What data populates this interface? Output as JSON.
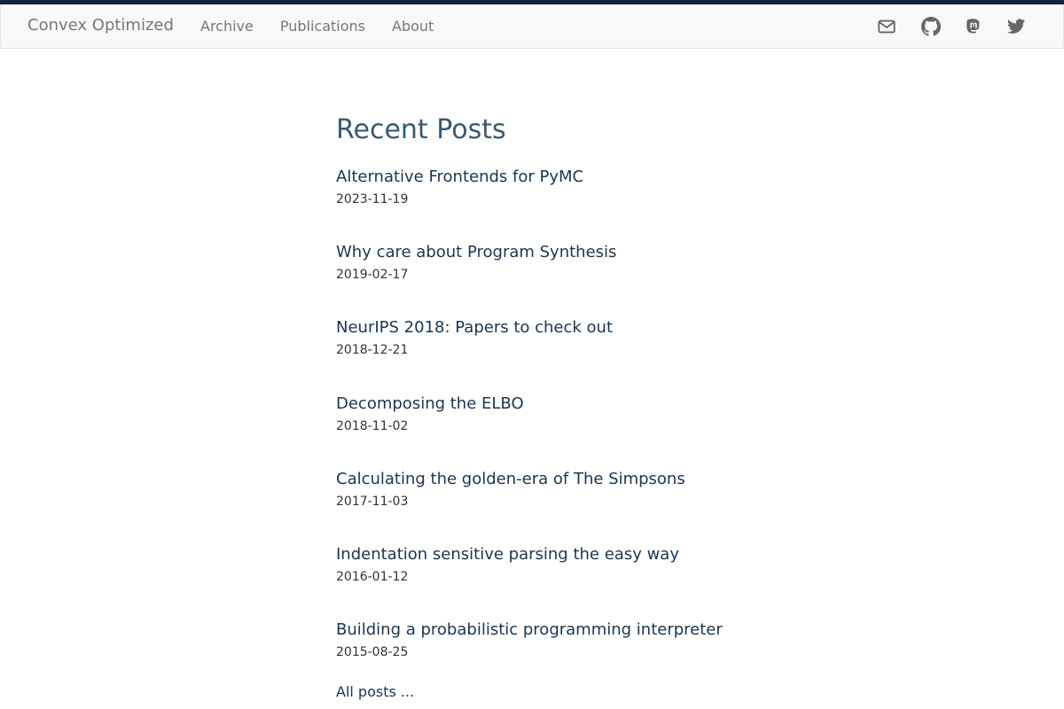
{
  "nav": {
    "brand": "Convex Optimized",
    "links": [
      "Archive",
      "Publications",
      "About"
    ]
  },
  "social_icons": [
    "mail-icon",
    "github-icon",
    "mastodon-icon",
    "twitter-icon"
  ],
  "colors": {
    "topbar": "#14243a",
    "navbar_bg": "#f8f8f8",
    "nav_text": "#777777",
    "heading": "#385a6f",
    "link": "#1b3550"
  },
  "main": {
    "heading": "Recent Posts",
    "posts": [
      {
        "title": "Alternative Frontends for PyMC",
        "date": "2023-11-19"
      },
      {
        "title": "Why care about Program Synthesis",
        "date": "2019-02-17"
      },
      {
        "title": "NeurIPS 2018: Papers to check out",
        "date": "2018-12-21"
      },
      {
        "title": "Decomposing the ELBO",
        "date": "2018-11-02"
      },
      {
        "title": "Calculating the golden-era of The Simpsons",
        "date": "2017-11-03"
      },
      {
        "title": "Indentation sensitive parsing the easy way",
        "date": "2016-01-12"
      },
      {
        "title": "Building a probabilistic programming interpreter",
        "date": "2015-08-25"
      }
    ],
    "all_posts": "All posts ..."
  }
}
